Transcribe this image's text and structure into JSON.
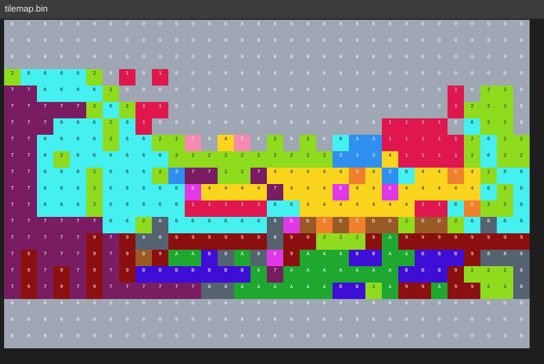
{
  "window": {
    "title": "tilemap.bin"
  },
  "tilemap": {
    "cols": 32,
    "rows": 20,
    "palette": {
      "0": "#9ea7b3",
      "1": "#e0164f",
      "2": "#8fdb1e",
      "3": "#2e8ff0",
      "4": "#fad41d",
      "5": "#f0802c",
      "6": "#44f0f0",
      "7": "#7a1c62",
      "8": "#556270",
      "9": "#8c0f0f",
      "A": "#1ea830",
      "B": "#3e0ed6",
      "C": "#f78ab0",
      "D": "#9a5a26",
      "E": "#e038e6"
    },
    "grid": [
      "00000000000000000000000000000000",
      "00000000000000000000000000000000",
      "00000000000000000000000000000000",
      "26666201010000000000000000000000",
      "77666620000000000000000000010220",
      "77777262110000000000000000012220",
      "77766626100000000000000111106220",
      "77666626622C04C020206331111126220",
      "77626666662222222222333411112622",
      "7766626662377227444445436445426660",
      "77666266666E44447444E44E44444626",
      "77666266666111116644444441165226",
      "77777766286666668ED5D5DD2DD26866",
      "77777979889999998992229A99999999",
      "79777979D9AAB8A8E9AAABBAABBB9888",
      "79797979BBBBBBBA7AAAAAAABBB92228",
      "79797977777788AAAAAABB2A99A99228",
      "00000000000000000000000000000000",
      "00000000000000000000000000000000",
      "00000000000000000000000000000000"
    ]
  }
}
